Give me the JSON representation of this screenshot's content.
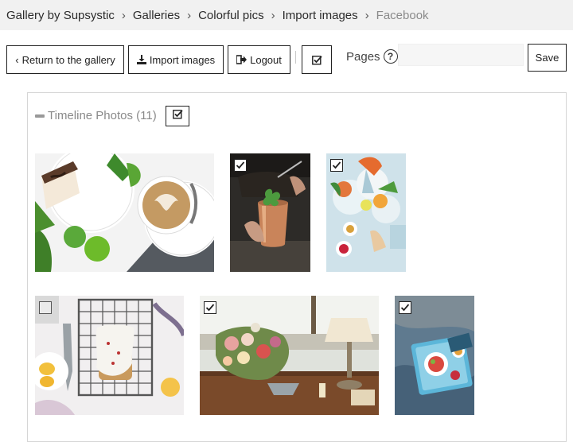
{
  "breadcrumb": {
    "items": [
      "Gallery by Supsystic",
      "Galleries",
      "Colorful pics",
      "Import images",
      "Facebook"
    ]
  },
  "toolbar": {
    "return_label": "Return to the gallery",
    "import_label": "Import images",
    "logout_label": "Logout",
    "pages_label": "Pages",
    "pages_placeholder": "",
    "save_label": "Save"
  },
  "section": {
    "title": "Timeline Photos (11)"
  },
  "photos": [
    {
      "name": "cake-coffee",
      "checked": false
    },
    {
      "name": "copper-cocktail",
      "checked": true
    },
    {
      "name": "blue-table-dishes",
      "checked": true
    },
    {
      "name": "loaf-on-rack",
      "checked": false
    },
    {
      "name": "flowers-lamp",
      "checked": true
    },
    {
      "name": "tray-on-bed",
      "checked": true
    }
  ],
  "icons": {
    "return": "chevron-left-icon",
    "import": "download-icon",
    "logout": "logout-icon",
    "select_all": "checkbox-checked-icon",
    "help": "question-circle-icon"
  }
}
